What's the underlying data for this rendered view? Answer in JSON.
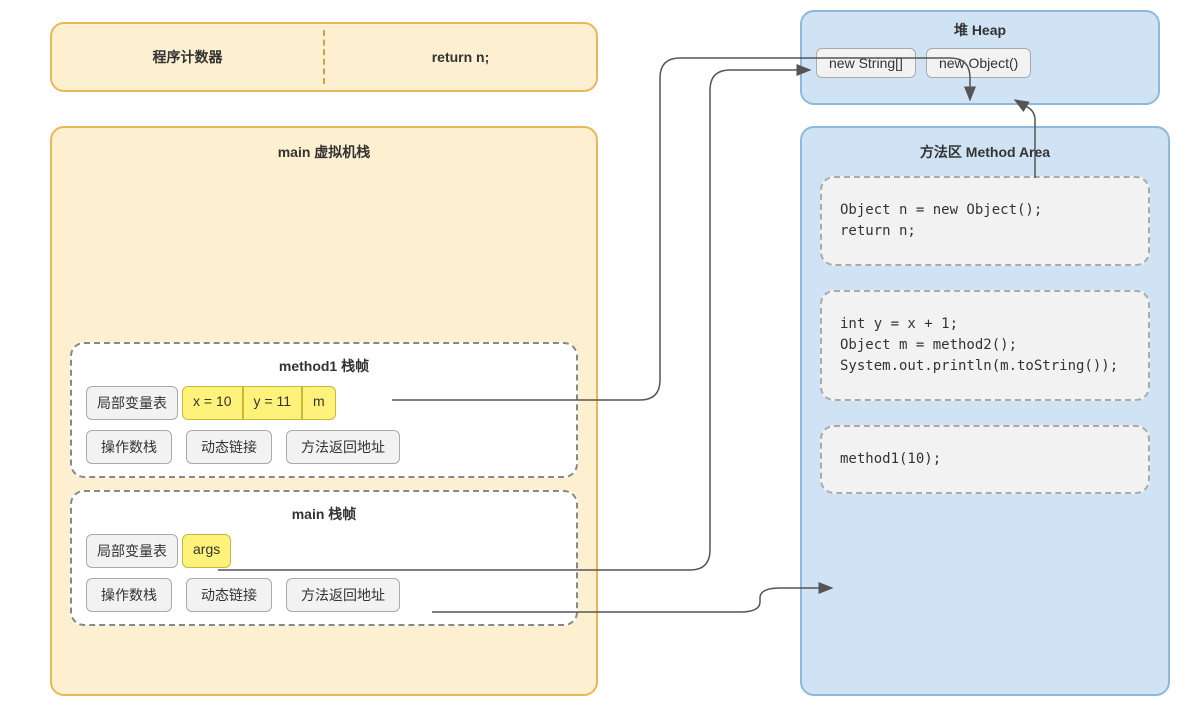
{
  "pc": {
    "left_label": "程序计数器",
    "right_label": "return n;"
  },
  "heap": {
    "title": "堆 Heap",
    "items": [
      "new String[]",
      "new Object()"
    ]
  },
  "stack": {
    "title": "main 虚拟机栈",
    "frames": {
      "method1": {
        "title": "method1 栈帧",
        "lv_label": "局部变量表",
        "vars": [
          "x = 10",
          "y = 11",
          "m"
        ],
        "buttons": [
          "操作数栈",
          "动态链接",
          "方法返回地址"
        ]
      },
      "main": {
        "title": "main 栈帧",
        "lv_label": "局部变量表",
        "vars": [
          "args"
        ],
        "buttons": [
          "操作数栈",
          "动态链接",
          "方法返回地址"
        ]
      }
    }
  },
  "method_area": {
    "title": "方法区 Method Area",
    "blocks": [
      "Object n = new Object();\nreturn n;",
      "int y = x + 1;\nObject m = method2();\nSystem.out.println(m.toString());",
      "method1(10);"
    ]
  },
  "arrows": [
    {
      "name": "args-to-newString",
      "desc": "main frame args → heap new String[]"
    },
    {
      "name": "m-to-newObject",
      "desc": "method1 frame m → heap new Object()"
    },
    {
      "name": "main-return-to-method1call",
      "desc": "main 方法返回地址 → method1(10);"
    },
    {
      "name": "codeblock1-to-newObject",
      "desc": "Object n = new Object() → heap new Object()"
    }
  ]
}
